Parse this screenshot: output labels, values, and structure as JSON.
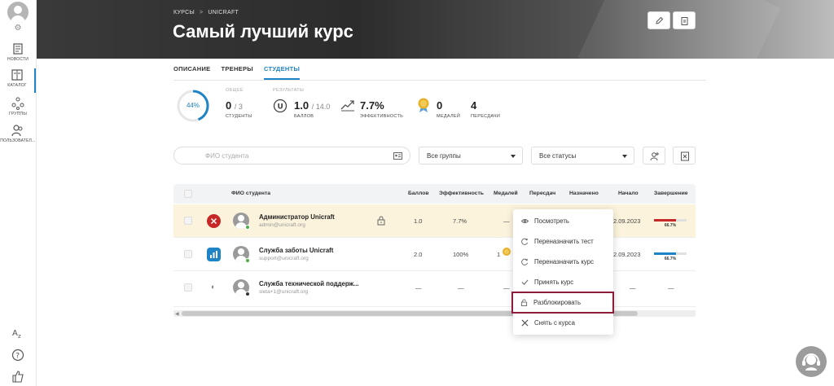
{
  "sidebar": {
    "items": [
      {
        "label": "НОВОСТИ",
        "icon": "news-icon"
      },
      {
        "label": "КАТАЛОГ",
        "icon": "catalog-icon"
      },
      {
        "label": "ГРУППЫ",
        "icon": "groups-icon"
      },
      {
        "label": "ПОЛЬЗОВАТЕЛ...",
        "icon": "users-icon"
      }
    ],
    "active_index": 1,
    "bottom_icons": [
      "translate-icon",
      "help-icon",
      "like-icon"
    ]
  },
  "header": {
    "breadcrumbs": [
      "КУРСЫ",
      "UNICRAFT"
    ],
    "breadcrumb_separator": ">",
    "title": "Самый лучший курс",
    "actions": [
      "edit-icon",
      "clipboard-icon"
    ]
  },
  "tabs": [
    {
      "label": "ОПИСАНИЕ",
      "active": false
    },
    {
      "label": "ТРЕНЕРЫ",
      "active": false
    },
    {
      "label": "СТУДЕНТЫ",
      "active": true
    }
  ],
  "stats": {
    "progress_percent": 44,
    "progress_label": "44%",
    "total_caption": "ОБЩЕЕ",
    "students_value": "0",
    "students_total": "/ 3",
    "students_caption": "СТУДЕНТЫ",
    "results_caption": "РЕЗУЛЬТАТЫ",
    "score_value": "1.0",
    "score_total": "/ 14.0",
    "score_caption": "БАЛЛОВ",
    "efficiency_value": "7.7%",
    "efficiency_caption": "ЭФФЕКТИВНОСТЬ",
    "medals_value": "0",
    "medals_caption": "МЕДАЛЕЙ",
    "retakes_value": "4",
    "retakes_caption": "ПЕРЕСДАЧИ"
  },
  "filters": {
    "search_placeholder": "ФИО студента",
    "groups_selected": "Все группы",
    "statuses_selected": "Все статусы"
  },
  "table": {
    "columns": [
      "ФИО студента",
      "Баллов",
      "Эффективность",
      "Медалей",
      "Пересдач",
      "Назначено",
      "Начало",
      "Завершение"
    ],
    "rows": [
      {
        "name": "Администратор Unicraft",
        "email": "admin@unicraft.org",
        "score": "1.0",
        "efficiency": "7.7%",
        "medals": "—",
        "start": "2.09.2023",
        "completion_label": "66.7%",
        "completion": 0.667,
        "status_color": "#c62828",
        "highlighted": true
      },
      {
        "name": "Служба заботы Unicraft",
        "email": "support@unicraft.org",
        "score": "2.0",
        "efficiency": "100%",
        "medals": "1",
        "start": "2.09.2023",
        "completion_label": "66.7%",
        "completion": 0.667,
        "status_color": "#1e84c6",
        "highlighted": false
      },
      {
        "name": "Служба технической поддерж...",
        "email": "sleta+1@unicraft.org",
        "score": "—",
        "efficiency": "—",
        "medals": "—",
        "start": "—",
        "completion_label": "—",
        "completion": null,
        "status_color": "",
        "highlighted": false
      }
    ]
  },
  "context_menu": {
    "items": [
      {
        "label": "Посмотреть",
        "icon": "eye-icon"
      },
      {
        "label": "Переназначить тест",
        "icon": "reassign-icon"
      },
      {
        "label": "Переназначить курс",
        "icon": "reassign-icon"
      },
      {
        "label": "Принять курс",
        "icon": "check-icon"
      },
      {
        "label": "Разблокировать",
        "icon": "unlock-icon"
      },
      {
        "label": "Снять с курса",
        "icon": "close-icon"
      }
    ],
    "selected_index": 4
  },
  "colors": {
    "accent": "#1e84c6",
    "danger": "#c62828",
    "highlight_row": "#fbf3dc",
    "selected_outline": "#8c1c3a"
  }
}
